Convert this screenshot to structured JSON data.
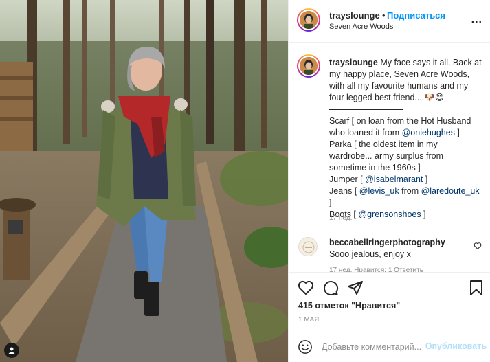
{
  "post": {
    "username": "trayslounge",
    "follow_label": "Подписаться",
    "dot": "•",
    "location": "Seven Acre Woods",
    "more_label": "..."
  },
  "caption": {
    "username": "trayslounge",
    "line1_text": " My face says it all. Back at",
    "line2": "my happy place, Seven Acre Woods,",
    "line3": "with all my favourite humans and my",
    "line4": "four legged best friend....🐶😊",
    "scarf_a": "Scarf [ on loan from the Hot Husband",
    "scarf_b_pre": "who loaned it from ",
    "scarf_b_mention": "@oniehughes",
    "scarf_b_post": " ]",
    "parka_a": "Parka [ the oldest item in my",
    "parka_b": "wardrobe... army surplus from",
    "parka_c": "sometime in the 1960s ]",
    "jumper_pre": "Jumper [ ",
    "jumper_mention": "@isabelmarant",
    "jumper_post": " ]",
    "jeans_pre": "Jeans [ ",
    "jeans_mention1": "@levis_uk",
    "jeans_mid": " from ",
    "jeans_mention2": "@laredoute_uk",
    "jeans_close": "]",
    "boots_pre": "Boots [ ",
    "boots_mention": "@grensonshoes",
    "boots_post": " ]",
    "time": "17 нед."
  },
  "comment": {
    "username": "beccabellringerphotography",
    "text": "Sooo jealous, enjoy x",
    "cut_text": "17 нед.  Нравится: 1  Ответить"
  },
  "actions": {
    "icons": [
      "heart-icon",
      "comment-icon",
      "share-icon",
      "bookmark-icon"
    ],
    "likes": "415 отметок \"Нравится\"",
    "date": "1 МАЯ"
  },
  "composer": {
    "placeholder": "Добавьте комментарий...",
    "post_label": "Опубликовать"
  },
  "colors": {
    "link": "#0095f6",
    "mention": "#00376b",
    "muted": "#8e8e8e",
    "post_disabled": "#b2dffc"
  }
}
